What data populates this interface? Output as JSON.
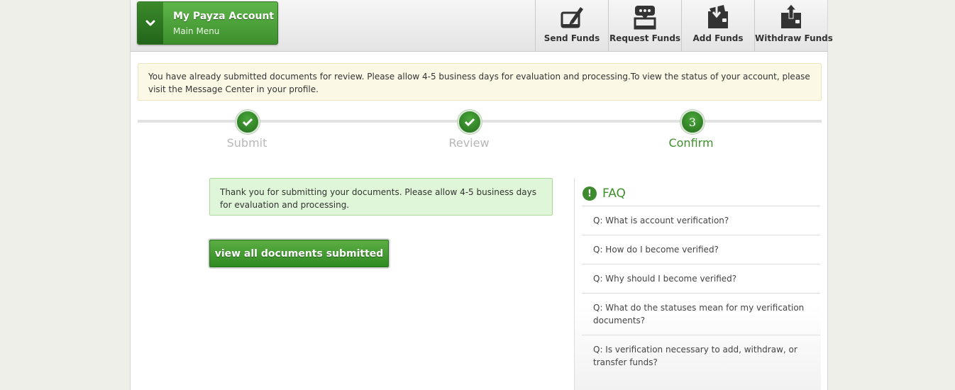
{
  "account_menu": {
    "title": "My Payza Account",
    "subtitle": "Main Menu"
  },
  "actions": [
    {
      "label": "Send Funds",
      "icon": "send-funds-icon"
    },
    {
      "label": "Request Funds",
      "icon": "request-funds-icon"
    },
    {
      "label": "Add Funds",
      "icon": "add-funds-icon"
    },
    {
      "label": "Withdraw Funds",
      "icon": "withdraw-funds-icon"
    }
  ],
  "notice": {
    "text": "You have already submitted documents for review. Please allow 4-5 business days for evaluation and processing.To view the status of your account, please visit the Message Center in your profile."
  },
  "steps": [
    {
      "label": "Submit",
      "state": "done"
    },
    {
      "label": "Review",
      "state": "done"
    },
    {
      "label": "Confirm",
      "state": "active",
      "number": "3"
    }
  ],
  "success": {
    "text": "Thank you for submitting your documents. Please allow 4-5 business days for evaluation and processing."
  },
  "view_button": {
    "label": "view all documents submitted"
  },
  "faq": {
    "title": "FAQ",
    "icon_glyph": "!",
    "items": [
      "Q: What is account verification?",
      "Q: How do I become verified?",
      "Q: Why should I become verified?",
      "Q: What do the statuses mean for my verification documents?",
      "Q: Is verification necessary to add, withdraw, or transfer funds?"
    ]
  },
  "colors": {
    "brand_green": "#3f8f2c",
    "notice_bg": "#fcf8e6",
    "success_bg": "#e0f6d8"
  }
}
